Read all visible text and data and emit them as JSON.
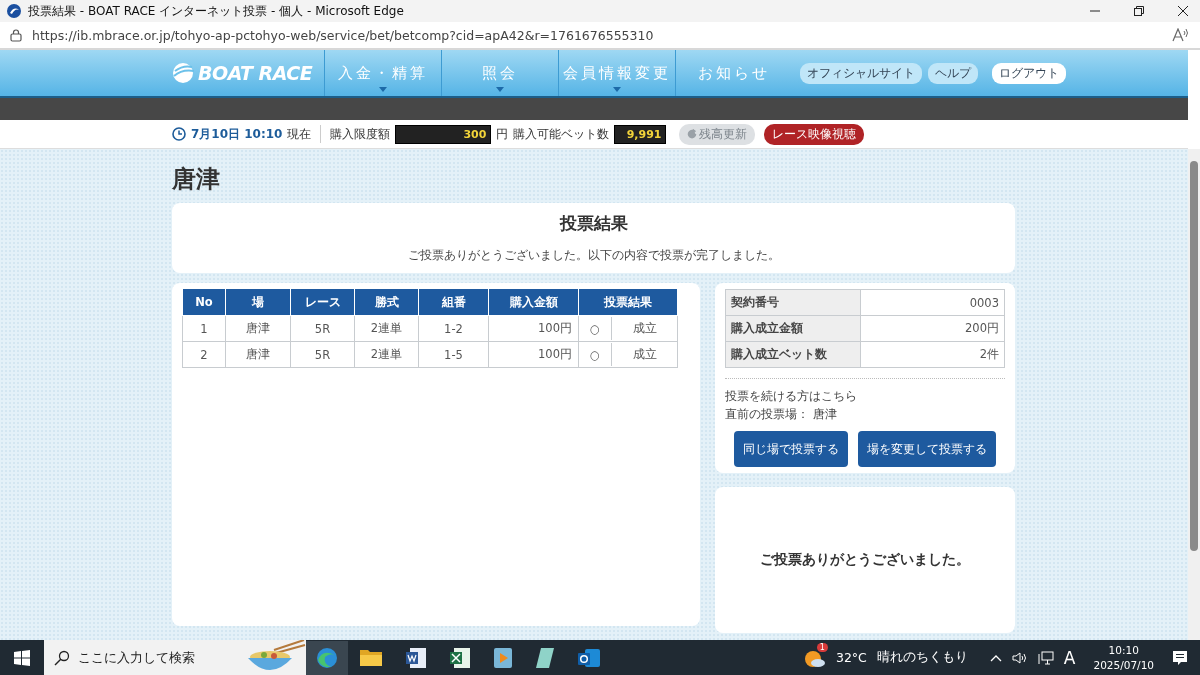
{
  "window": {
    "title": "投票結果 - BOAT RACE インターネット投票 - 個人 - Microsoft Edge"
  },
  "address_bar": {
    "url": "https://ib.mbrace.or.jp/tohyo-ap-pctohyo-web/service/bet/betcomp?cid=apA42&r=1761676555310"
  },
  "nav": {
    "logo": "BOAT RACE",
    "menus": [
      {
        "label": "入金・精算",
        "dropdown": true
      },
      {
        "label": "照会",
        "dropdown": true
      },
      {
        "label": "会員情報変更",
        "dropdown": true
      },
      {
        "label": "お知らせ",
        "dropdown": false
      }
    ],
    "links": [
      {
        "label": "オフィシャルサイト",
        "kind": "pill"
      },
      {
        "label": "ヘルプ",
        "kind": "pill"
      },
      {
        "label": "ログアウト",
        "kind": "logout"
      }
    ]
  },
  "info_bar": {
    "datetime": "7月10日 10:10",
    "now": "現在",
    "limit_label": "購入限度額",
    "limit_value": "300",
    "limit_unit": "円",
    "bets_label": "購入可能ベット数",
    "bets_value": "9,991",
    "buttons": [
      {
        "label": "残高更新",
        "kind": "refresh",
        "disabled": true
      },
      {
        "label": "レース映像視聴",
        "kind": "video",
        "disabled": false
      }
    ]
  },
  "page_title": "唐津",
  "result_card": {
    "title": "投票結果",
    "message": "ご投票ありがとうございました。以下の内容で投票が完了しました。"
  },
  "bets_table": {
    "columns": [
      "No",
      "場",
      "レース",
      "勝式",
      "組番",
      "購入金額",
      "投票結果"
    ],
    "rows": [
      {
        "cells": [
          "1",
          "唐津",
          "5R",
          "2連単",
          "1-2",
          "100円"
        ],
        "result_mark": "○",
        "result": "成立"
      },
      {
        "cells": [
          "2",
          "唐津",
          "5R",
          "2連単",
          "1-5",
          "100円"
        ],
        "result_mark": "○",
        "result": "成立"
      }
    ]
  },
  "summary": {
    "rows": [
      {
        "label": "契約番号",
        "value": "0003"
      },
      {
        "label": "購入成立金額",
        "value": "200円"
      },
      {
        "label": "購入成立ベット数",
        "value": "2件"
      }
    ],
    "continue_text": "投票を続ける方はこちら",
    "previous_venue": "直前の投票場： 唐津",
    "buttons": [
      "同じ場で投票する",
      "場を変更して投票する"
    ]
  },
  "thanks": "ご投票ありがとうございました。",
  "taskbar": {
    "search_placeholder": "ここに入力して検索",
    "weather_badge": "1",
    "temperature": "32°C",
    "weather": "晴れのちくもり",
    "ime": "A",
    "time": "10:10",
    "date": "2025/07/10"
  }
}
